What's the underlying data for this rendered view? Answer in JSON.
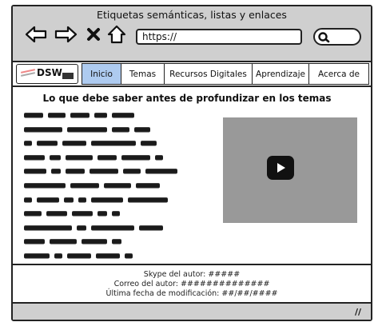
{
  "window": {
    "title": "Etiquetas semánticas, listas y enlaces"
  },
  "toolbar": {
    "url": "https://",
    "icons": [
      "back-arrow-icon",
      "forward-arrow-icon",
      "close-x-icon",
      "home-icon",
      "search-icon"
    ]
  },
  "brand": {
    "logo_text": "DSW"
  },
  "nav": {
    "items": [
      {
        "label": "Inicio",
        "active": true
      },
      {
        "label": "Temas"
      },
      {
        "label": "Recursos Digitales"
      },
      {
        "label": "Aprendizaje"
      },
      {
        "label": "Acerca de"
      }
    ]
  },
  "main": {
    "heading": "Lo que debe saber antes de profundizar en los temas",
    "video": {
      "icon": "play-icon"
    }
  },
  "footer": {
    "skype": "Skype del autor: #####",
    "email": "Correo del autor: ##############",
    "modified": "Última fecha de modificación: ##/##/####"
  },
  "colors": {
    "chrome": "#cfcfcf",
    "active_tab": "#aecbf0",
    "video_bg": "#999999"
  }
}
